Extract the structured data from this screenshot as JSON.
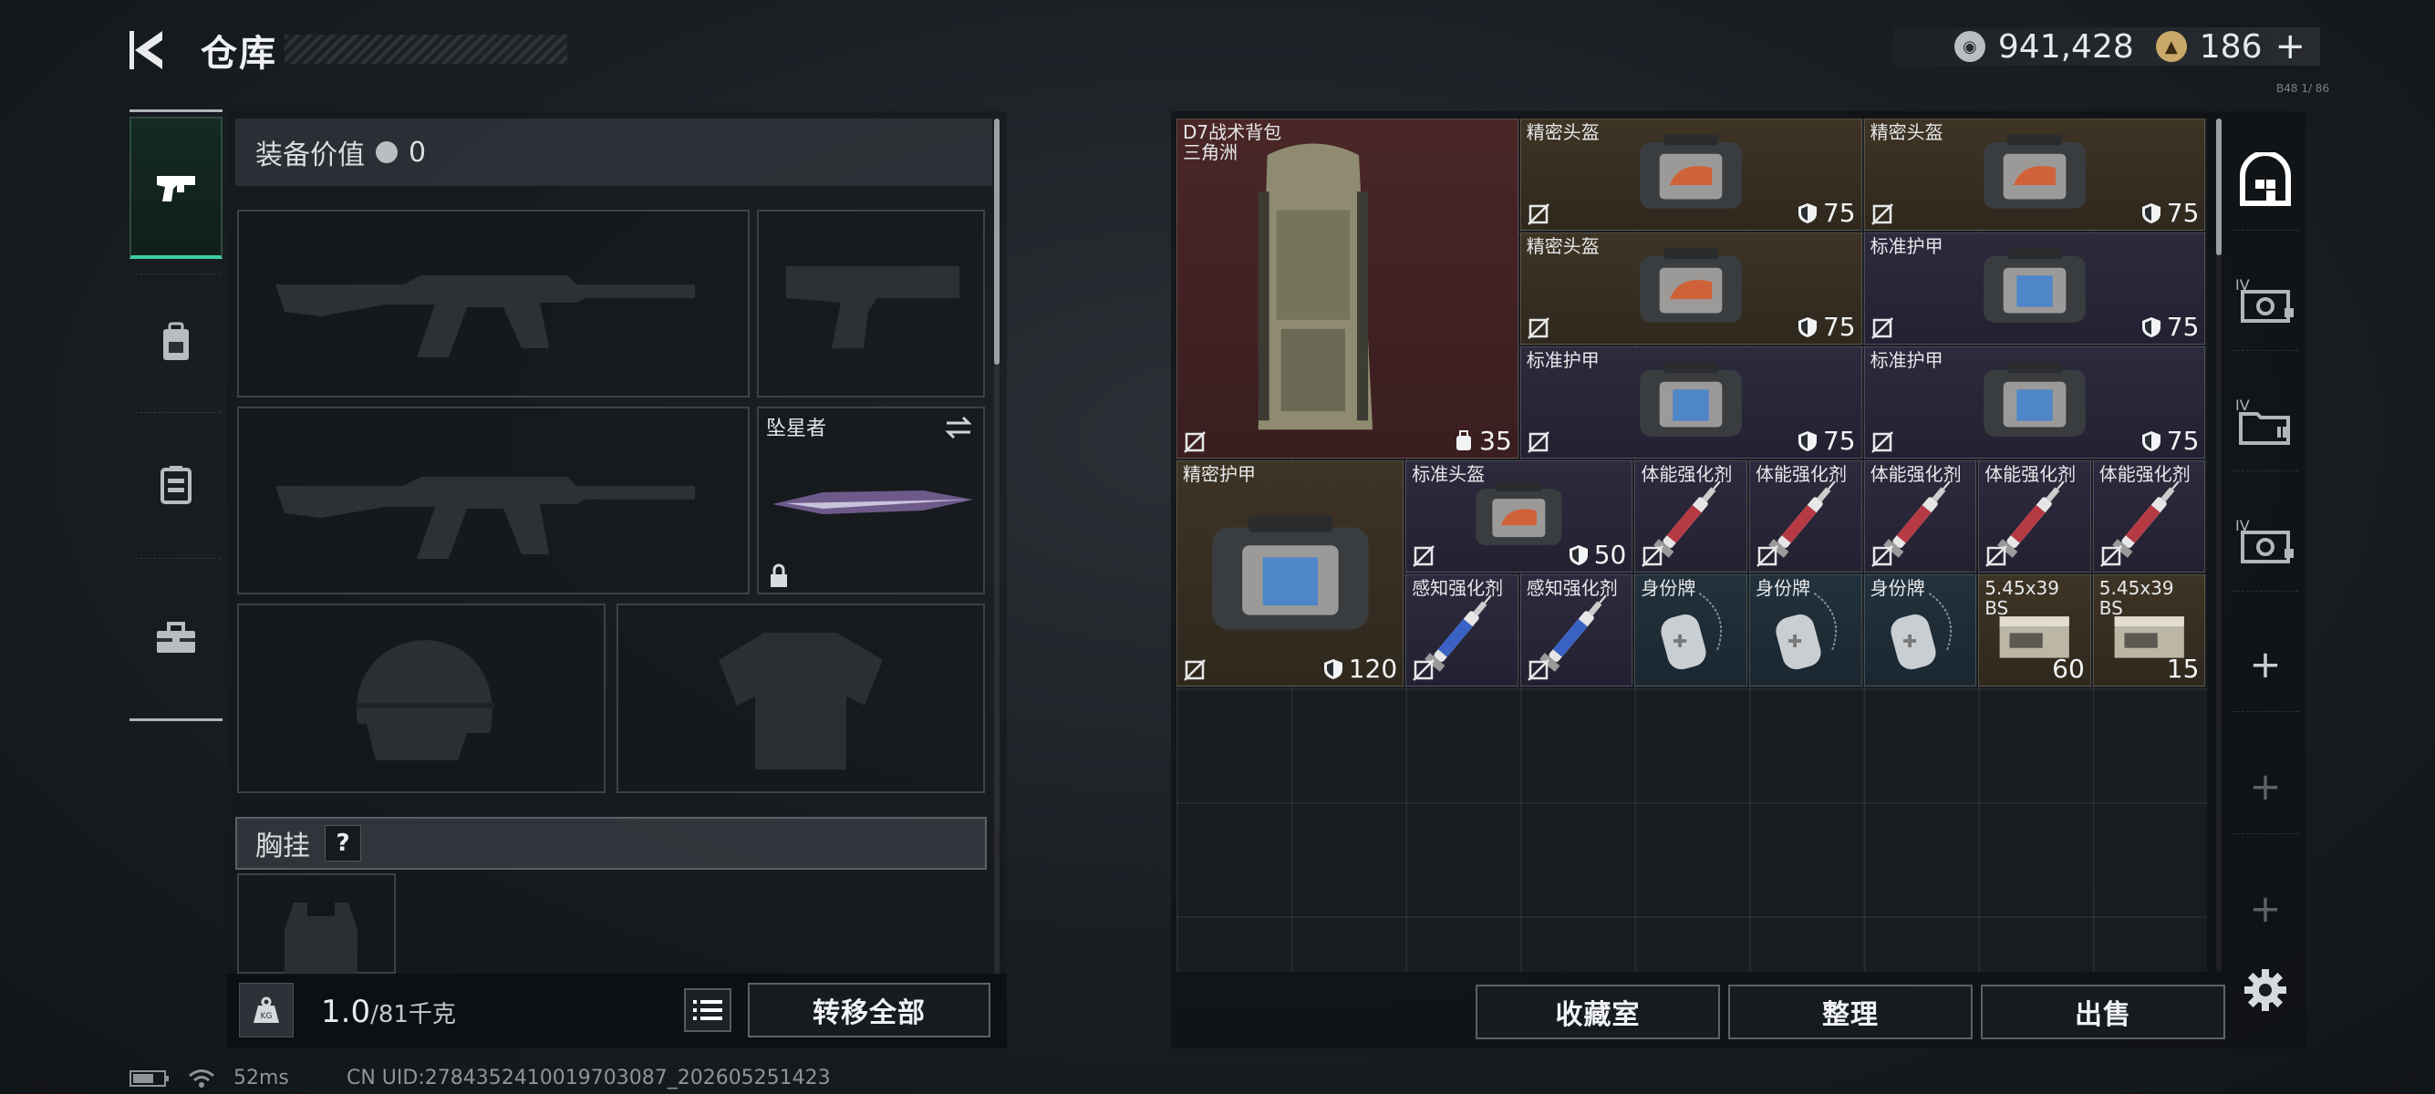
{
  "header": {
    "title": "仓库",
    "currency": [
      {
        "icon": "silver-coin-icon",
        "value": "941,428"
      },
      {
        "icon": "gold-triangle-coin-icon",
        "value": "186"
      }
    ],
    "add_label": "+"
  },
  "categories": [
    {
      "icon": "pistol-icon",
      "active": true
    },
    {
      "icon": "backpack-icon",
      "active": false
    },
    {
      "icon": "vest-icon",
      "active": false
    },
    {
      "icon": "toolbox-icon",
      "active": false
    }
  ],
  "equipment": {
    "value_label": "装备价值",
    "value": "0",
    "slot_knife_label": "坠星者",
    "chest_rig_label": "胸挂",
    "help_label": "?",
    "weight_current": "1.0",
    "weight_max": "/81千克",
    "transfer_all_label": "转移全部"
  },
  "stash": {
    "items": [
      {
        "name": "D7战术背包",
        "name2": "三角洲",
        "stat": "35",
        "stat_icon": "backpack-capacity-icon",
        "rarity": "red"
      },
      {
        "name": "精密头盔",
        "stat": "75",
        "stat_icon": "durability-shield-icon",
        "rarity": "gold"
      },
      {
        "name": "精密头盔",
        "stat": "75",
        "stat_icon": "durability-shield-icon",
        "rarity": "gold"
      },
      {
        "name": "精密头盔",
        "stat": "75",
        "stat_icon": "durability-shield-icon",
        "rarity": "gold"
      },
      {
        "name": "标准护甲",
        "stat": "75",
        "stat_icon": "durability-shield-icon",
        "rarity": "purple"
      },
      {
        "name": "标准护甲",
        "stat": "75",
        "stat_icon": "durability-shield-icon",
        "rarity": "purple"
      },
      {
        "name": "标准护甲",
        "stat": "75",
        "stat_icon": "durability-shield-icon",
        "rarity": "purple"
      },
      {
        "name": "精密护甲",
        "stat": "120",
        "stat_icon": "durability-shield-icon",
        "rarity": "gold"
      },
      {
        "name": "标准头盔",
        "stat": "50",
        "stat_icon": "durability-shield-icon",
        "rarity": "purple"
      },
      {
        "name": "体能强化剂",
        "rarity": "purple"
      },
      {
        "name": "体能强化剂",
        "rarity": "purple"
      },
      {
        "name": "体能强化剂",
        "rarity": "purple"
      },
      {
        "name": "体能强化剂",
        "rarity": "purple"
      },
      {
        "name": "体能强化剂",
        "rarity": "purple"
      },
      {
        "name": "感知强化剂",
        "rarity": "purple"
      },
      {
        "name": "感知强化剂",
        "rarity": "purple"
      },
      {
        "name": "身份牌",
        "rarity": "blue"
      },
      {
        "name": "身份牌",
        "rarity": "blue"
      },
      {
        "name": "身份牌",
        "rarity": "blue"
      },
      {
        "name": "5.45x39",
        "name2": "BS",
        "count": "60",
        "rarity": "gold"
      },
      {
        "name": "5.45x39",
        "name2": "BS",
        "count": "15",
        "rarity": "gold"
      }
    ],
    "buttons": {
      "collection": "收藏室",
      "sort": "整理",
      "sell": "出售"
    }
  },
  "sidebar": {
    "icons": [
      "stash-icon",
      "stash-expansion-iv-icon",
      "stash-folder-iv-icon",
      "stash-expansion-iv-icon-2"
    ],
    "plus_label": "+"
  },
  "status": {
    "ping": "52ms",
    "uid": "CN UID:2784352410019703087_202605251423",
    "corner_tag": "B48 1/ 86"
  },
  "colors": {
    "accent_green": "#3ed0a0",
    "rarity_red": "#4a2627",
    "rarity_gold": "#3e3425",
    "rarity_purple": "#2d2a3d",
    "rarity_blue": "#22313c"
  }
}
